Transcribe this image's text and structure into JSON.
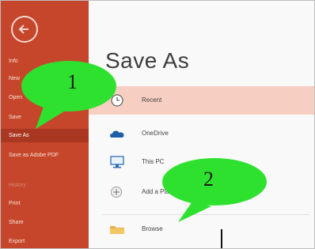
{
  "sidebar": {
    "items": [
      {
        "label": "Info"
      },
      {
        "label": "New"
      },
      {
        "label": "Open"
      },
      {
        "label": "Save"
      },
      {
        "label": "Save As"
      },
      {
        "label": "Save as Adobe PDF"
      },
      {
        "label": "History"
      },
      {
        "label": "Print"
      },
      {
        "label": "Share"
      },
      {
        "label": "Export"
      }
    ]
  },
  "main": {
    "title": "Save As",
    "locations": [
      {
        "label": "Recent",
        "icon": "clock-icon",
        "selected": true
      },
      {
        "label": "OneDrive",
        "icon": "cloud-icon",
        "selected": false
      },
      {
        "label": "This PC",
        "icon": "computer-icon",
        "selected": false
      },
      {
        "label": "Add a Place",
        "icon": "add-place-icon",
        "selected": false
      },
      {
        "label": "Browse",
        "icon": "folder-icon",
        "selected": false
      }
    ]
  },
  "callouts": [
    {
      "number": "1"
    },
    {
      "number": "2"
    }
  ],
  "colors": {
    "sidebar": "#c5462a",
    "sidebar_active": "#a93722",
    "selected_row": "#f7cfc2",
    "callout": "#2fe12f"
  }
}
